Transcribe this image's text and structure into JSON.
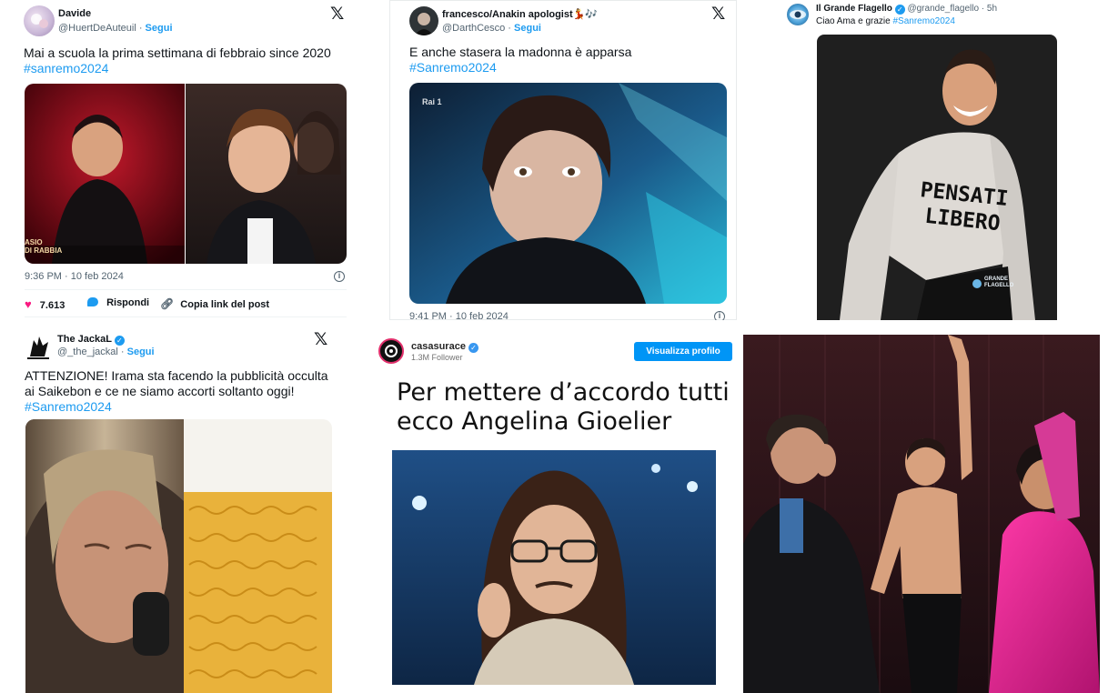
{
  "tweet1": {
    "name": "Davide",
    "handle": "@HuertDeAuteuil",
    "separator": " · ",
    "follow": "Segui",
    "text": "Mai a scuola la prima settimana di febbraio since 2020",
    "hashtag": "#sanremo2024",
    "timestamp": "9:36 PM · 10 feb 2024",
    "likes": "7.613",
    "reply_label": "Rispondi",
    "copy_label": "Copia link del post",
    "image_caption_1": "ASIO",
    "image_caption_2": "DI RABBIA"
  },
  "tweet2": {
    "name": "francesco/Anakin apologist",
    "name_emoji": "💃🎶",
    "handle": "@DarthCesco",
    "separator": " · ",
    "follow": "Segui",
    "text": "E anche stasera la madonna è apparsa",
    "hashtag": "#Sanremo2024",
    "timestamp": "9:41 PM · 10 feb 2024",
    "tv_logo": "Rai 1"
  },
  "tweet3": {
    "name": "Il Grande Flagello",
    "handle": "@grande_flagello · 5h",
    "text": "Ciao Ama e grazie",
    "hashtag": "#Sanremo2024",
    "shirt_line1": "PENSATI",
    "shirt_line2": "LIBERO",
    "watermark": "GRANDE FLAGELLO"
  },
  "tweet4": {
    "name": "The JackaL",
    "handle": "@_the_jackal",
    "separator": " · ",
    "follow": "Segui",
    "text": "ATTENZIONE! Irama sta facendo la pubblicità occulta ai Saikebon e ce ne siamo accorti soltanto oggi!",
    "hashtag": "#Sanremo2024"
  },
  "instagram": {
    "username": "casasurace",
    "followers": "1.3M Follower",
    "button": "Visualizza profilo",
    "headline_line1": "Per mettere d’accordo tutti",
    "headline_line2": "ecco Angelina Gioelier"
  },
  "colors": {
    "accent": "#1d9bf0",
    "like": "#f91880",
    "text": "#0f1419",
    "muted": "#536471"
  }
}
